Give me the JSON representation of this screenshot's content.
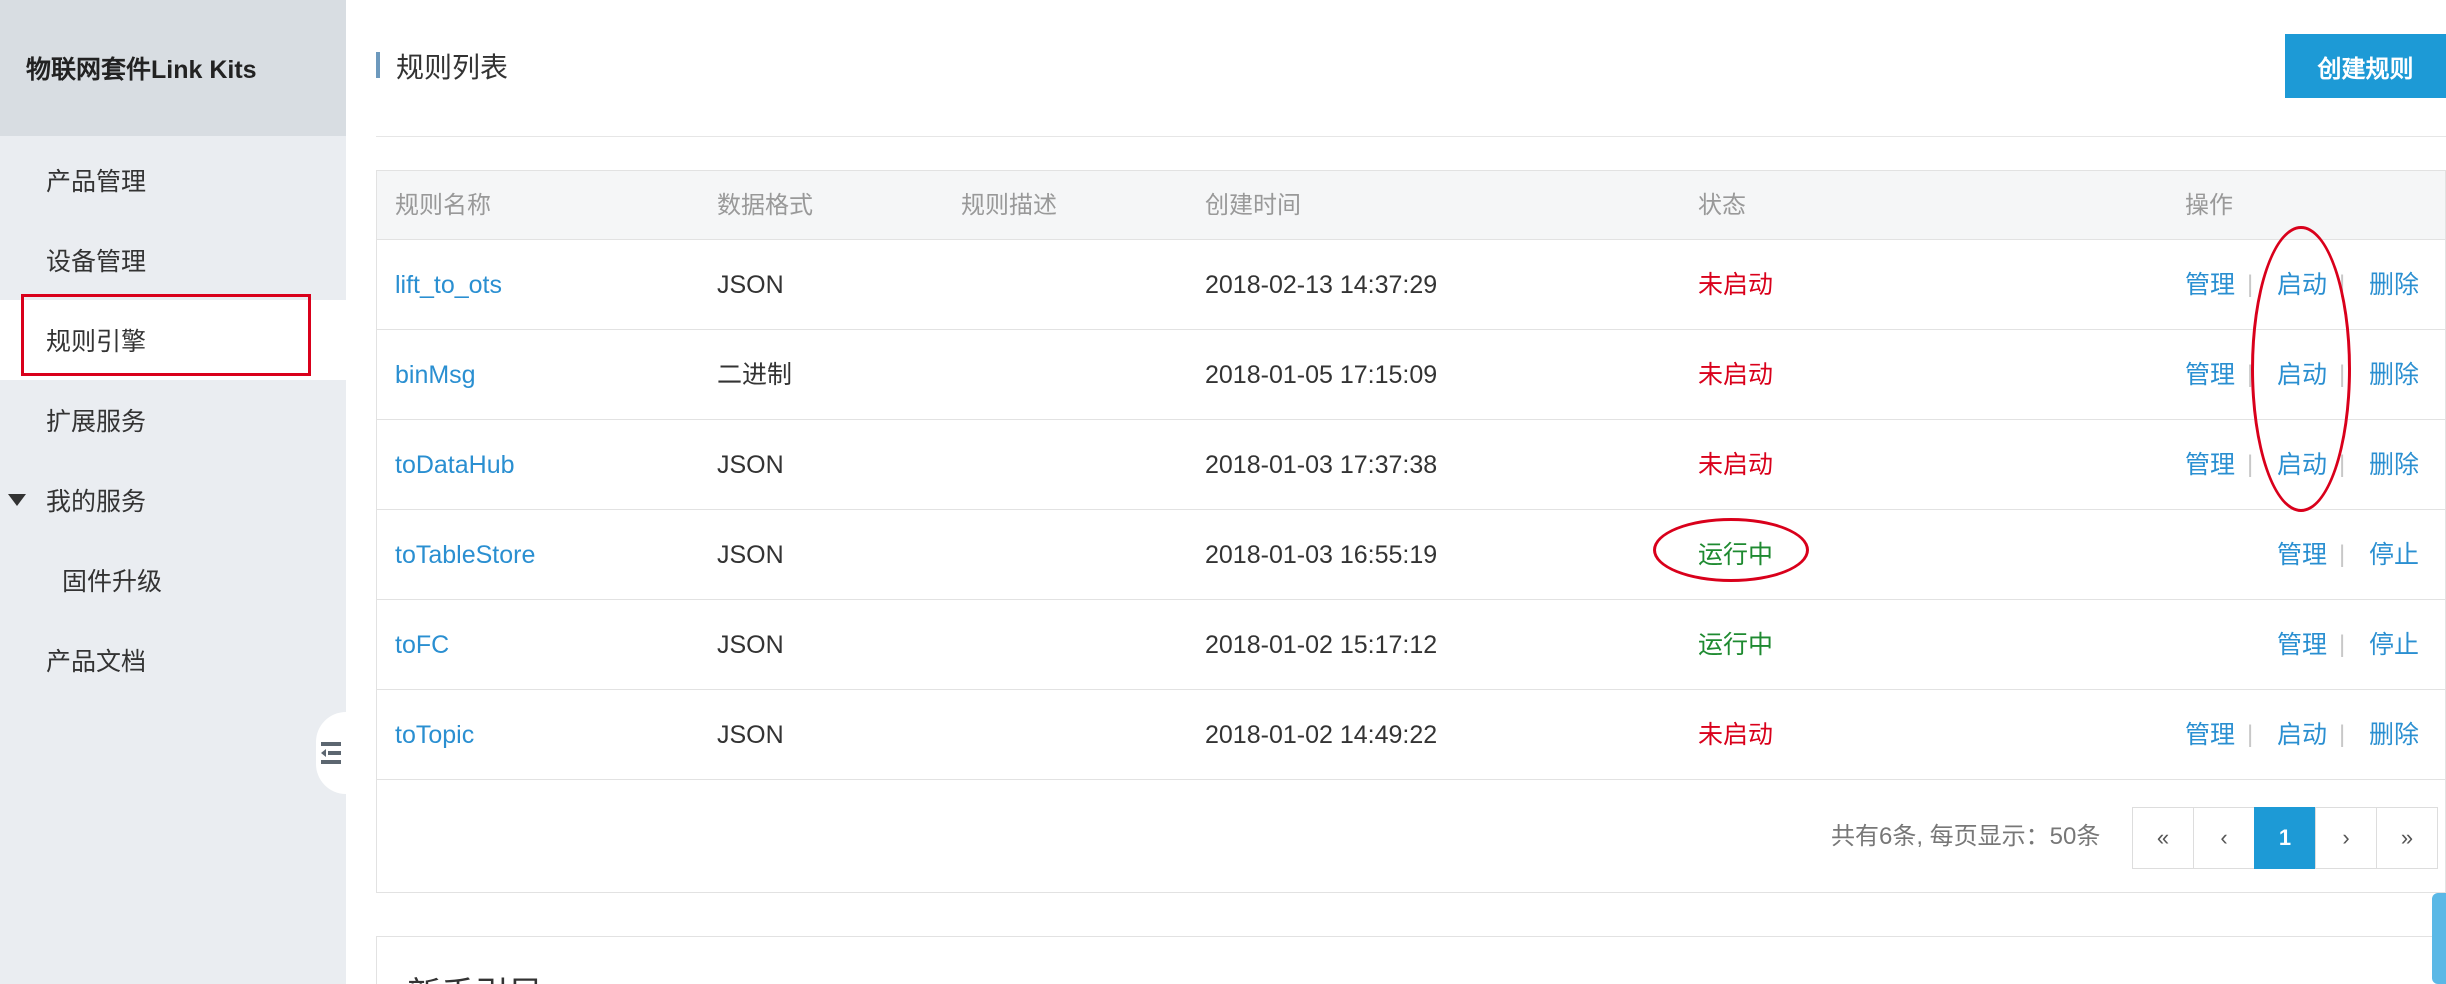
{
  "sidebar": {
    "title": "物联网套件Link Kits",
    "items": [
      {
        "label": "产品管理"
      },
      {
        "label": "设备管理"
      },
      {
        "label": "规则引擎"
      },
      {
        "label": "扩展服务"
      },
      {
        "label": "我的服务"
      },
      {
        "label": "固件升级"
      },
      {
        "label": "产品文档"
      }
    ],
    "collapse_icon": "collapse-sidebar-icon"
  },
  "header": {
    "title": "规则列表",
    "create_button": "创建规则"
  },
  "table": {
    "columns": [
      "规则名称",
      "数据格式",
      "规则描述",
      "创建时间",
      "状态",
      "操作"
    ],
    "rows": [
      {
        "name": "lift_to_ots",
        "format": "JSON",
        "description": "",
        "created": "2018-02-13 14:37:29",
        "status": "未启动",
        "actions": [
          "管理",
          "启动",
          "删除"
        ]
      },
      {
        "name": "binMsg",
        "format": "二进制",
        "description": "",
        "created": "2018-01-05 17:15:09",
        "status": "未启动",
        "actions": [
          "管理",
          "启动",
          "删除"
        ]
      },
      {
        "name": "toDataHub",
        "format": "JSON",
        "description": "",
        "created": "2018-01-03 17:37:38",
        "status": "未启动",
        "actions": [
          "管理",
          "启动",
          "删除"
        ]
      },
      {
        "name": "toTableStore",
        "format": "JSON",
        "description": "",
        "created": "2018-01-03 16:55:19",
        "status": "运行中",
        "actions": [
          "管理",
          "停止"
        ]
      },
      {
        "name": "toFC",
        "format": "JSON",
        "description": "",
        "created": "2018-01-02 15:17:12",
        "status": "运行中",
        "actions": [
          "管理",
          "停止"
        ]
      },
      {
        "name": "toTopic",
        "format": "JSON",
        "description": "",
        "created": "2018-01-02 14:49:22",
        "status": "未启动",
        "actions": [
          "管理",
          "启动",
          "删除"
        ]
      }
    ],
    "separator": "|"
  },
  "pagination": {
    "summary": "共有6条, 每页显示：50条",
    "first": "«",
    "prev": "‹",
    "current": "1",
    "next": "›",
    "last": "»"
  },
  "next_section": {
    "title": "新手引导"
  },
  "colors": {
    "accent": "#1d9ad6",
    "link": "#2a8fd1",
    "status_stopped": "#d9001b",
    "status_running": "#1e8a30",
    "annotation": "#d9001b"
  }
}
